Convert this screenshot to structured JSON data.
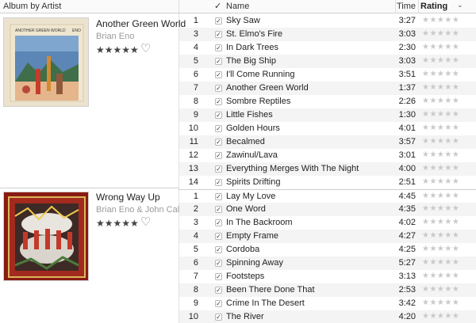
{
  "header": {
    "album_label": "Album by Artist",
    "check_label": "✓",
    "name_label": "Name",
    "time_label": "Time",
    "rating_label": "Rating",
    "chevron": "⌄"
  },
  "albums": [
    {
      "title": "Another Green World",
      "artist": "Brian Eno",
      "rating_stars": "★★★★★",
      "love_icon": "♡",
      "art_text_title": "ANOTHER GREEN WORLD",
      "art_text_artist": "ENO",
      "tracks": [
        {
          "num": "1",
          "name": "Sky Saw",
          "time": "3:27",
          "checked": true
        },
        {
          "num": "3",
          "name": "St. Elmo's Fire",
          "time": "3:03",
          "checked": true
        },
        {
          "num": "4",
          "name": "In Dark Trees",
          "time": "2:30",
          "checked": true
        },
        {
          "num": "5",
          "name": "The Big Ship",
          "time": "3:03",
          "checked": true
        },
        {
          "num": "6",
          "name": "I'll Come Running",
          "time": "3:51",
          "checked": true
        },
        {
          "num": "7",
          "name": "Another Green World",
          "time": "1:37",
          "checked": true
        },
        {
          "num": "8",
          "name": "Sombre Reptiles",
          "time": "2:26",
          "checked": true
        },
        {
          "num": "9",
          "name": "Little Fishes",
          "time": "1:30",
          "checked": true
        },
        {
          "num": "10",
          "name": "Golden Hours",
          "time": "4:01",
          "checked": true
        },
        {
          "num": "11",
          "name": "Becalmed",
          "time": "3:57",
          "checked": true
        },
        {
          "num": "12",
          "name": "Zawinul/Lava",
          "time": "3:01",
          "checked": true
        },
        {
          "num": "13",
          "name": "Everything Merges With The Night",
          "time": "4:00",
          "checked": true
        },
        {
          "num": "14",
          "name": "Spirits Drifting",
          "time": "2:51",
          "checked": true
        }
      ]
    },
    {
      "title": "Wrong Way Up",
      "artist": "Brian Eno & John Cale",
      "rating_stars": "★★★★★",
      "love_icon": "♡",
      "tracks": [
        {
          "num": "1",
          "name": "Lay My Love",
          "time": "4:45",
          "checked": true
        },
        {
          "num": "2",
          "name": "One Word",
          "time": "4:35",
          "checked": true
        },
        {
          "num": "3",
          "name": "In The Backroom",
          "time": "4:02",
          "checked": true
        },
        {
          "num": "4",
          "name": "Empty Frame",
          "time": "4:27",
          "checked": true
        },
        {
          "num": "5",
          "name": "Cordoba",
          "time": "4:25",
          "checked": true
        },
        {
          "num": "6",
          "name": "Spinning Away",
          "time": "5:27",
          "checked": true
        },
        {
          "num": "7",
          "name": "Footsteps",
          "time": "3:13",
          "checked": true
        },
        {
          "num": "8",
          "name": "Been There Done That",
          "time": "2:53",
          "checked": true
        },
        {
          "num": "9",
          "name": "Crime In The Desert",
          "time": "3:42",
          "checked": true
        },
        {
          "num": "10",
          "name": "The River",
          "time": "4:20",
          "checked": true
        }
      ]
    }
  ],
  "track_rating_stars": "★★★★★",
  "check_glyph": "✓",
  "colors": {
    "album_art_1_bg": "#e9dcc4",
    "album_art_2_bg": "#8a1a12",
    "row_alt": "#f4f4f4"
  }
}
